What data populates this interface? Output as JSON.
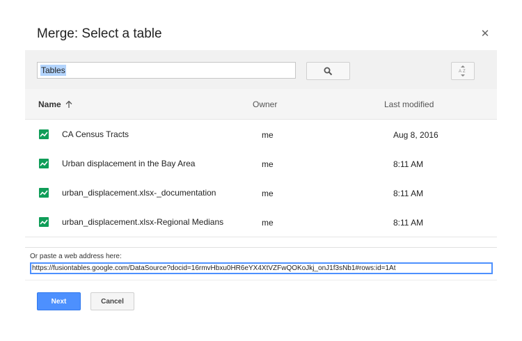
{
  "dialog": {
    "title": "Merge: Select a table",
    "close_icon": "close-icon"
  },
  "toolbar": {
    "search_value": "Tables",
    "search_icon": "search-icon",
    "sort_icon": "sort-az-icon"
  },
  "list": {
    "headers": {
      "name": "Name",
      "owner": "Owner",
      "last_modified": "Last modified"
    },
    "sort_icon": "arrow-up-icon",
    "rows": [
      {
        "name": "CA Census Tracts",
        "owner": "me",
        "modified": "Aug 8, 2016",
        "icon": "table-chart-icon"
      },
      {
        "name": "Urban displacement in the Bay Area",
        "owner": "me",
        "modified": "8:11 AM",
        "icon": "table-chart-icon"
      },
      {
        "name": "urban_displacement.xlsx-_documentation",
        "owner": "me",
        "modified": "8:11 AM",
        "icon": "table-chart-icon"
      },
      {
        "name": "urban_displacement.xlsx-Regional Medians",
        "owner": "me",
        "modified": "8:11 AM",
        "icon": "table-chart-icon"
      }
    ]
  },
  "paste": {
    "label": "Or paste a web address here:",
    "url": "https://fusiontables.google.com/DataSource?docid=16rmvHbxu0HR6eYX4XtVZFwQOKoJkj_onJ1f3sNb1#rows:id=1At"
  },
  "footer": {
    "next_label": "Next",
    "cancel_label": "Cancel"
  },
  "colors": {
    "accent": "#4d90fe",
    "icon_green": "#0f9d58"
  }
}
